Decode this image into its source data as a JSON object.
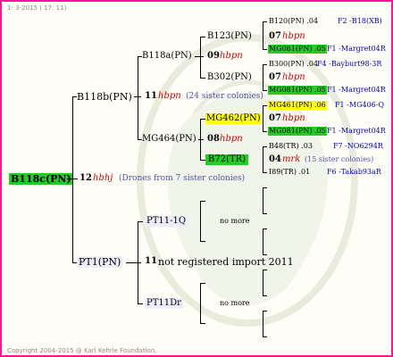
{
  "header": {
    "date_line": "1-  3-2015  ( 17: 11)"
  },
  "footer": {
    "copyright": "Copyright 2004-2015 @ Karl Kehrle Foundation."
  },
  "colors": {
    "border": "#ff1493",
    "highlight_green": "#22cc22",
    "highlight_yellow": "#ffff00",
    "pedigree_blue": "#0000cc",
    "drone_red": "#cc0000"
  },
  "root": {
    "name": "B118c(PN)",
    "year": "12",
    "mark": "hbhj",
    "note": "(Drones from 7 sister colonies)"
  },
  "sire": {
    "name": "B118b(PN)",
    "year": "11",
    "mark": "hbpn",
    "note": "(24 sister colonies)",
    "b118a": {
      "name": "B118a(PN)",
      "year": "09",
      "mark": "hbpn",
      "b123": {
        "name": "B123(PN)",
        "year": "07",
        "mark": "hbpn",
        "rows": [
          {
            "name": "B120(PN) .04",
            "ref": "F2 -B18(XB)"
          },
          {
            "name": "MG081(PN) .05",
            "ref": "F1 -Margret04R"
          }
        ]
      },
      "b302": {
        "name": "B302(PN)",
        "year": "07",
        "mark": "hbpn",
        "rows": [
          {
            "name": "B300(PN) .04",
            "ref": "F4 -Bayburt98-3R"
          },
          {
            "name": "MG081(PN) .05",
            "ref": "F1 -Margret04R"
          }
        ]
      }
    },
    "mg464": {
      "name": "MG464(PN)",
      "year": "08",
      "mark": "hbpn",
      "mg462": {
        "name": "MG462(PN)",
        "year": "07",
        "mark": "hbpn",
        "rows": [
          {
            "name": "MG461(PN) .06",
            "ref": "F1 -MG406-Q"
          },
          {
            "name": "MG081(PN) .05",
            "ref": "F1 -Margret04R"
          }
        ]
      },
      "b72": {
        "name": "B72(TR)",
        "year": "04",
        "mark": "mrk",
        "note": "(15 sister colonies)",
        "rows": [
          {
            "name": "B48(TR) .03",
            "ref": "F7 -NO6294R"
          },
          {
            "name": "I89(TR) .01",
            "ref": "F6 -Takab93aR"
          }
        ]
      }
    }
  },
  "dam": {
    "name": "PT1(PN)",
    "year": "11",
    "note": "not registered import 2011",
    "pt11q": {
      "name": "PT11-1Q",
      "more": "no more"
    },
    "pt11dr": {
      "name": "PT11Dr",
      "more": "no more"
    }
  }
}
